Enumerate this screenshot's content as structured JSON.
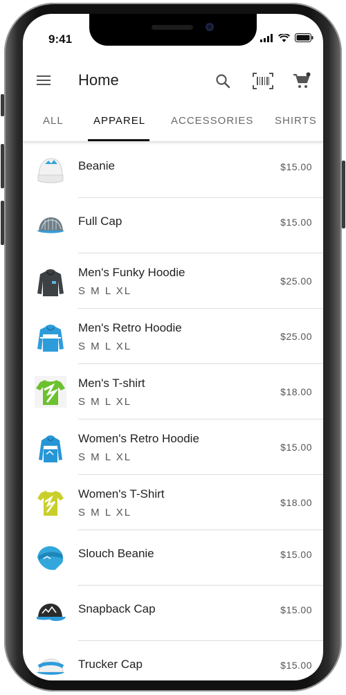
{
  "status": {
    "time": "9:41"
  },
  "appbar": {
    "title": "Home",
    "actions": [
      "search-icon",
      "barcode-scanner-icon",
      "cart-icon"
    ]
  },
  "tabs": [
    {
      "label": "ALL",
      "active": false
    },
    {
      "label": "APPAREL",
      "active": true
    },
    {
      "label": "ACCESSORIES",
      "active": false
    },
    {
      "label": "SHIRTS",
      "active": false
    }
  ],
  "products": [
    {
      "name": "Beanie",
      "sizes": "",
      "price": "$15.00",
      "icon": "beanie-icon"
    },
    {
      "name": "Full Cap",
      "sizes": "",
      "price": "$15.00",
      "icon": "cap-icon"
    },
    {
      "name": "Men's Funky Hoodie",
      "sizes": "S M L XL",
      "price": "$25.00",
      "icon": "hoodie-icon"
    },
    {
      "name": "Men's Retro Hoodie",
      "sizes": "S M L XL",
      "price": "$25.00",
      "icon": "hoodie-icon"
    },
    {
      "name": "Men's T-shirt",
      "sizes": "S M L XL",
      "price": "$18.00",
      "icon": "tshirt-icon"
    },
    {
      "name": "Women's Retro Hoodie",
      "sizes": "S M L XL",
      "price": "$15.00",
      "icon": "hoodie-icon"
    },
    {
      "name": "Women's T-Shirt",
      "sizes": "S M L XL",
      "price": "$18.00",
      "icon": "tshirt-icon"
    },
    {
      "name": "Slouch Beanie",
      "sizes": "",
      "price": "$15.00",
      "icon": "beanie-icon"
    },
    {
      "name": "Snapback Cap",
      "sizes": "",
      "price": "$15.00",
      "icon": "cap-icon"
    },
    {
      "name": "Trucker Cap",
      "sizes": "",
      "price": "$15.00",
      "icon": "cap-icon"
    }
  ],
  "colors": {
    "text": "#212121",
    "secondary": "#555555",
    "divider": "#dcdcdc",
    "accent": "#111111"
  }
}
